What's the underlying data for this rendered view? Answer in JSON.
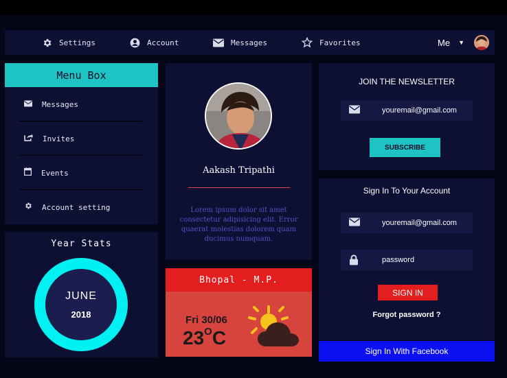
{
  "nav": {
    "items": [
      {
        "label": "Settings",
        "icon": "gear-icon"
      },
      {
        "label": "Account",
        "icon": "user-circle-icon"
      },
      {
        "label": "Messages",
        "icon": "envelope-icon"
      },
      {
        "label": "Favorites",
        "icon": "star-icon"
      }
    ],
    "user_label": "Me",
    "caret": "▼"
  },
  "menu": {
    "title": "Menu Box",
    "items": [
      {
        "label": "Messages",
        "icon": "envelope-icon"
      },
      {
        "label": "Invites",
        "icon": "share-icon"
      },
      {
        "label": "Events",
        "icon": "calendar-icon"
      },
      {
        "label": "Account setting",
        "icon": "gear-icon"
      }
    ]
  },
  "stats": {
    "title": "Year Stats",
    "month": "JUNE",
    "year": "2018"
  },
  "profile": {
    "name": "Aakash Tripathi",
    "bio": "Lorem ipsum dolor sit amet consectetur adipisicing elit. Error quaerat molestias dolorem quam ducimus numquam."
  },
  "weather": {
    "location": "Bhopal - M.P.",
    "date": "Fri 30/06",
    "temp": "23",
    "unit": "C",
    "icon": "partly-cloudy-icon"
  },
  "newsletter": {
    "title": "JOIN THE NEWSLETTER",
    "email_value": "youremail@gmail.com",
    "button": "SUBSCRIBE"
  },
  "signin": {
    "title": "Sign In To Your Account",
    "email_value": "youremail@gmail.com",
    "password_value": "password",
    "button": "SIGN IN",
    "forgot": "Forgot password ?",
    "facebook": "Sign In With Facebook"
  },
  "colors": {
    "background": "#050618",
    "panel": "#0d0f33",
    "accent_teal": "#1ec3c3",
    "ring_cyan": "#00f1f4",
    "accent_red": "#e21e1e",
    "weather_red": "#d7433d",
    "facebook_blue": "#0a10ef"
  }
}
